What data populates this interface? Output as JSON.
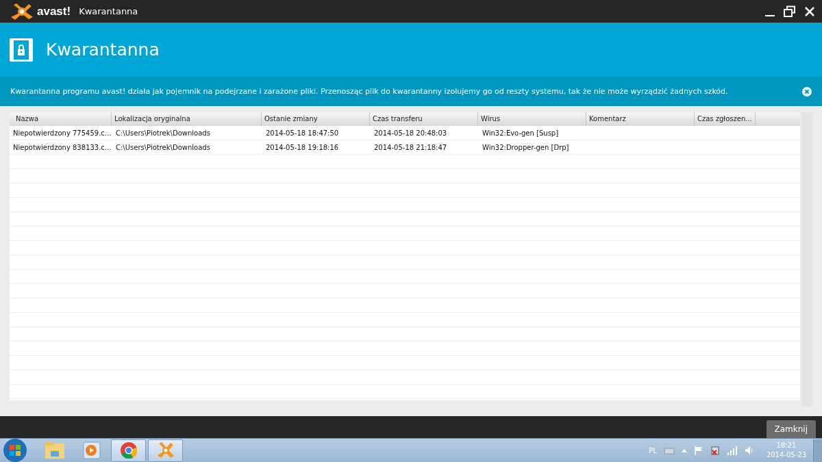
{
  "window": {
    "brand": "avast!",
    "title": "Kwarantanna"
  },
  "header": {
    "title": "Kwarantanna"
  },
  "info": {
    "text": "Kwarantanna programu avast! działa jak pojemnik na podejrzane i zarażone pliki. Przenosząc plik do kwarantanny izolujemy go od reszty systemu, tak że nie może wyrządzić żadnych szkód."
  },
  "table": {
    "columns": [
      "Nazwa",
      "Lokalizacja oryginalna",
      "Ostanie zmiany",
      "Czas transferu",
      "Wirus",
      "Komentarz",
      "Czas zgłoszen..."
    ],
    "rows": [
      [
        "Niepotwierdzony 775459.c...",
        "C:\\Users\\Piotrek\\Downloads",
        "2014-05-18 18:47:50",
        "2014-05-18 20:48:03",
        "Win32:Evo-gen [Susp]",
        "",
        ""
      ],
      [
        "Niepotwierdzony 838133.c...",
        "C:\\Users\\Piotrek\\Downloads",
        "2014-05-18 19:18:16",
        "2014-05-18 21:18:47",
        "Win32:Dropper-gen [Drp]",
        "",
        ""
      ]
    ]
  },
  "footer": {
    "button": "Zamknij"
  },
  "taskbar": {
    "apps": [
      {
        "kind": "folder",
        "selected": false
      },
      {
        "kind": "media",
        "selected": false
      },
      {
        "kind": "chrome",
        "selected": true
      },
      {
        "kind": "avast",
        "selected": true
      }
    ],
    "language": "PL",
    "time": "18:21",
    "date": "2014-05-23"
  }
}
